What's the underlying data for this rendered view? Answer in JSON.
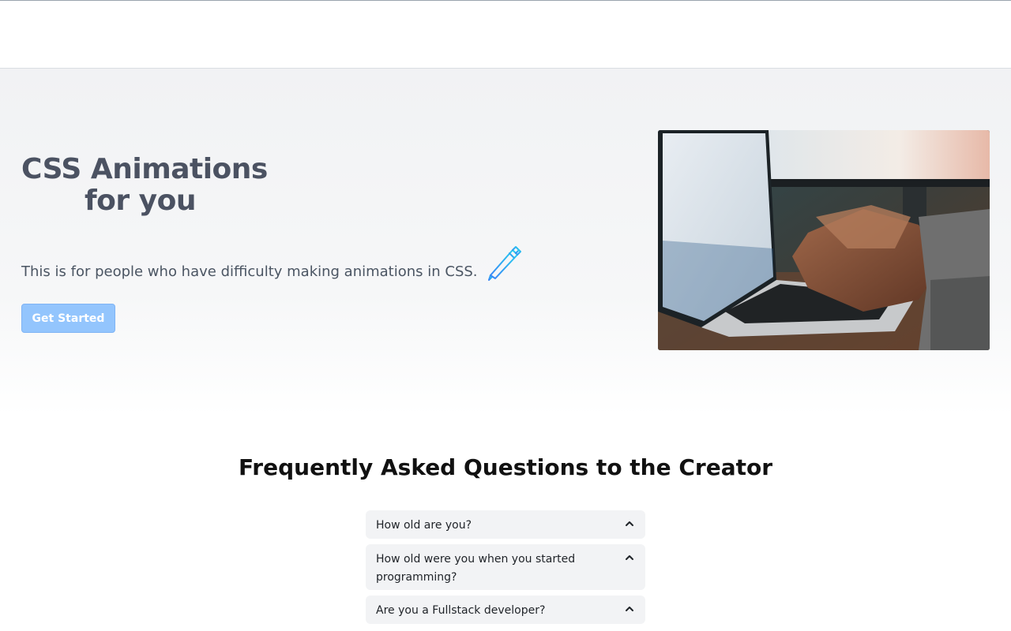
{
  "hero": {
    "title_line1": "CSS Animations",
    "title_line2": "for you",
    "subtitle": "This is for people who have difficulty making animations in CSS.",
    "cta_label": "Get Started",
    "cta_color": "#93c5fd",
    "photo_icon": "laptop-typing-photo",
    "pen_icon": "pen-icon"
  },
  "faq": {
    "title": "Frequently Asked Questions to the Creator",
    "items": [
      {
        "question": "How old are you?"
      },
      {
        "question": "How old were you when you started programming?"
      },
      {
        "question": "Are you a Fullstack developer?"
      }
    ],
    "chevron_icon": "chevron-up-icon"
  },
  "colors": {
    "title_text": "#4b5262",
    "faq_bg": "#f2f3f5"
  }
}
